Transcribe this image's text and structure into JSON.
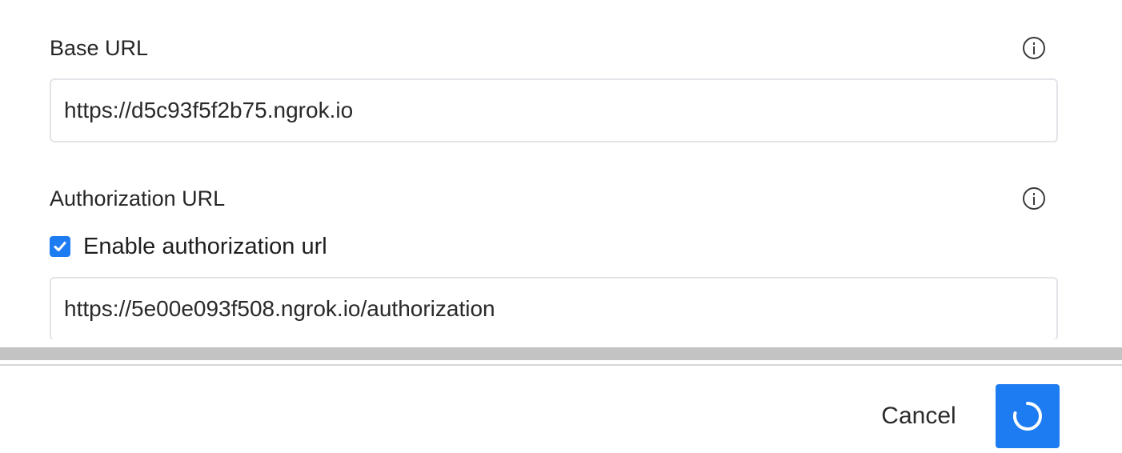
{
  "form": {
    "base_url": {
      "label": "Base URL",
      "value": "https://d5c93f5f2b75.ngrok.io",
      "info_icon": "info-icon"
    },
    "authorization_url": {
      "label": "Authorization URL",
      "info_icon": "info-icon",
      "checkbox_label": "Enable authorization url",
      "checkbox_checked": true,
      "value": "https://5e00e093f508.ngrok.io/authorization"
    }
  },
  "footer": {
    "cancel_label": "Cancel",
    "submit_state": "loading",
    "accent_color": "#1e7cf2"
  }
}
